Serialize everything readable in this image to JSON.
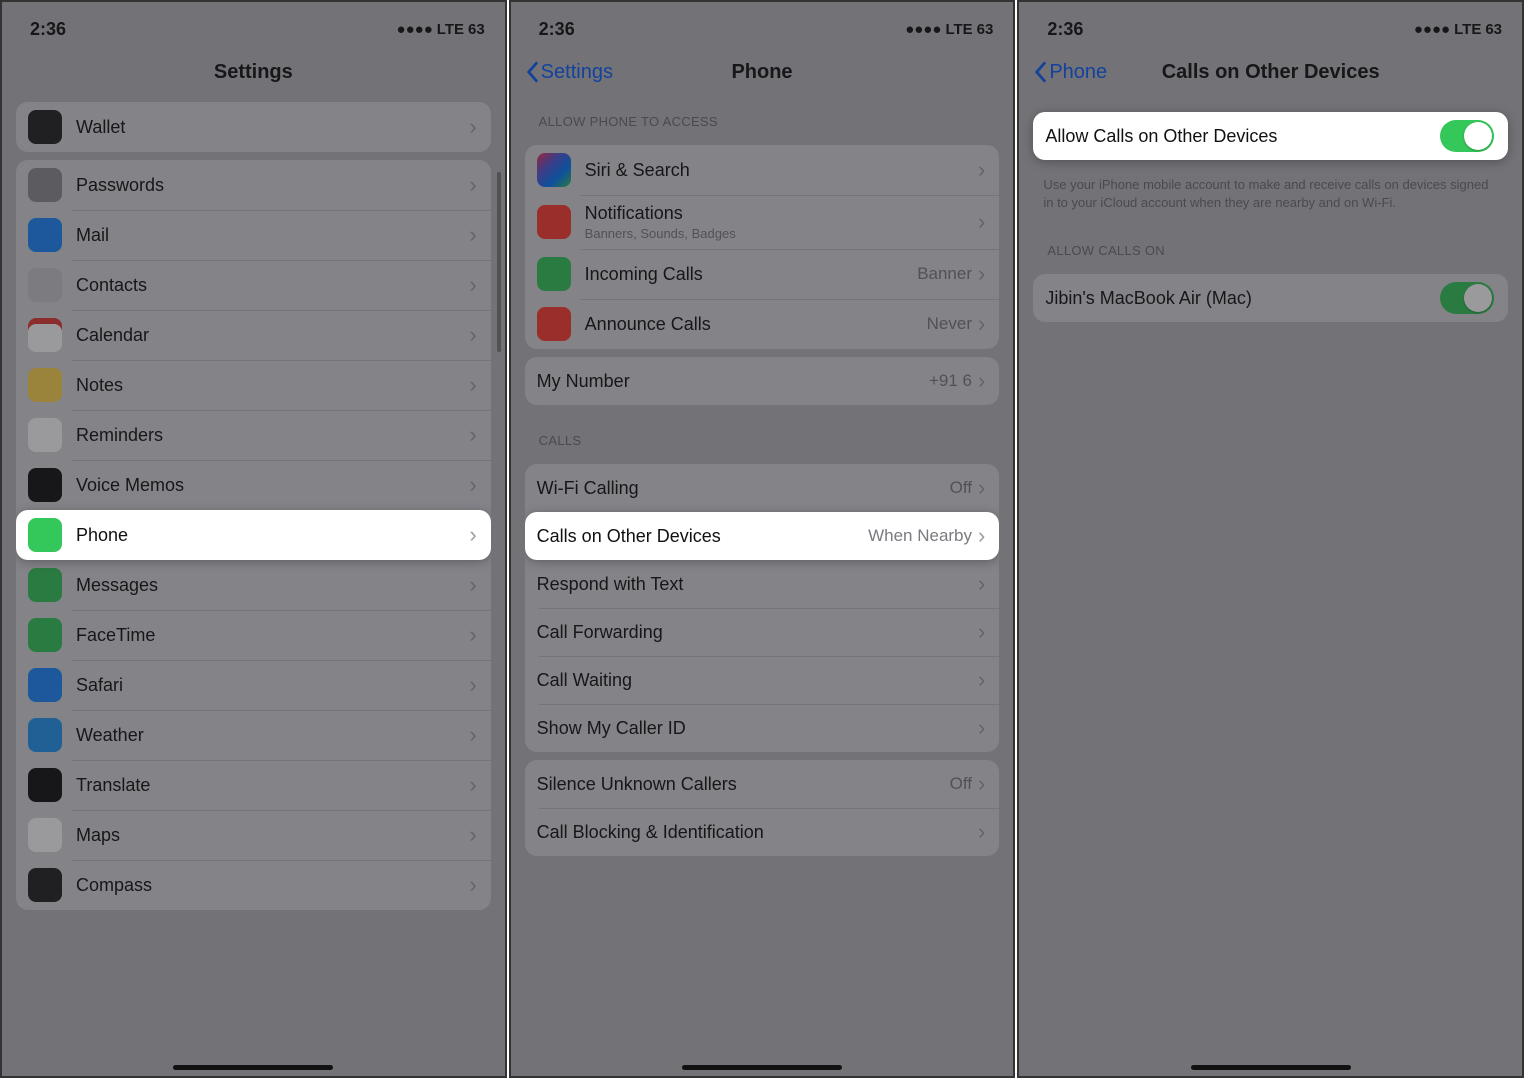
{
  "status": {
    "time": "2:36",
    "carrier": "LTE",
    "battery": "63"
  },
  "pane1": {
    "title": "Settings",
    "group_a": [
      {
        "name": "wallet",
        "label": "Wallet",
        "icon": "ic-wallet"
      }
    ],
    "group_b": [
      {
        "name": "passwords",
        "label": "Passwords",
        "icon": "ic-pass"
      },
      {
        "name": "mail",
        "label": "Mail",
        "icon": "ic-mail"
      },
      {
        "name": "contacts",
        "label": "Contacts",
        "icon": "ic-contacts"
      },
      {
        "name": "calendar",
        "label": "Calendar",
        "icon": "ic-cal"
      },
      {
        "name": "notes",
        "label": "Notes",
        "icon": "ic-notes"
      },
      {
        "name": "reminders",
        "label": "Reminders",
        "icon": "ic-rem"
      },
      {
        "name": "voicememos",
        "label": "Voice Memos",
        "icon": "ic-vm"
      },
      {
        "name": "phone",
        "label": "Phone",
        "icon": "ic-phone",
        "highlighted": true
      },
      {
        "name": "messages",
        "label": "Messages",
        "icon": "ic-msg"
      },
      {
        "name": "facetime",
        "label": "FaceTime",
        "icon": "ic-ft"
      },
      {
        "name": "safari",
        "label": "Safari",
        "icon": "ic-safari"
      },
      {
        "name": "weather",
        "label": "Weather",
        "icon": "ic-weather"
      },
      {
        "name": "translate",
        "label": "Translate",
        "icon": "ic-trans"
      },
      {
        "name": "maps",
        "label": "Maps",
        "icon": "ic-maps"
      },
      {
        "name": "compass",
        "label": "Compass",
        "icon": "ic-comp"
      }
    ]
  },
  "pane2": {
    "back": "Settings",
    "title": "Phone",
    "section_allow": "ALLOW PHONE TO ACCESS",
    "access_rows": [
      {
        "name": "siri",
        "label": "Siri & Search",
        "icon": "ic-siri"
      },
      {
        "name": "notif",
        "label": "Notifications",
        "sub": "Banners, Sounds, Badges",
        "icon": "ic-notif"
      },
      {
        "name": "incoming",
        "label": "Incoming Calls",
        "val": "Banner",
        "icon": "ic-inc"
      },
      {
        "name": "announce",
        "label": "Announce Calls",
        "val": "Never",
        "icon": "ic-annc"
      }
    ],
    "mynumber": {
      "label": "My Number",
      "val": "+91               6"
    },
    "section_calls": "CALLS",
    "calls_rows": [
      {
        "name": "wificalling",
        "label": "Wi-Fi Calling",
        "val": "Off"
      },
      {
        "name": "otherdev",
        "label": "Calls on Other Devices",
        "val": "When Nearby",
        "highlighted": true
      },
      {
        "name": "respond",
        "label": "Respond with Text"
      },
      {
        "name": "forward",
        "label": "Call Forwarding"
      },
      {
        "name": "waiting",
        "label": "Call Waiting"
      },
      {
        "name": "callerid",
        "label": "Show My Caller ID"
      }
    ],
    "last_rows": [
      {
        "name": "silence",
        "label": "Silence Unknown Callers",
        "val": "Off"
      },
      {
        "name": "blocking",
        "label": "Call Blocking & Identification"
      }
    ]
  },
  "pane3": {
    "back": "Phone",
    "title": "Calls on Other Devices",
    "allow_row": {
      "label": "Allow Calls on Other Devices"
    },
    "note": "Use your iPhone mobile account to make and receive calls on devices signed in to your iCloud account when they are nearby and on Wi-Fi.",
    "section_allow_on": "ALLOW CALLS ON",
    "device_row": {
      "label": "Jibin's MacBook Air (Mac)"
    }
  }
}
